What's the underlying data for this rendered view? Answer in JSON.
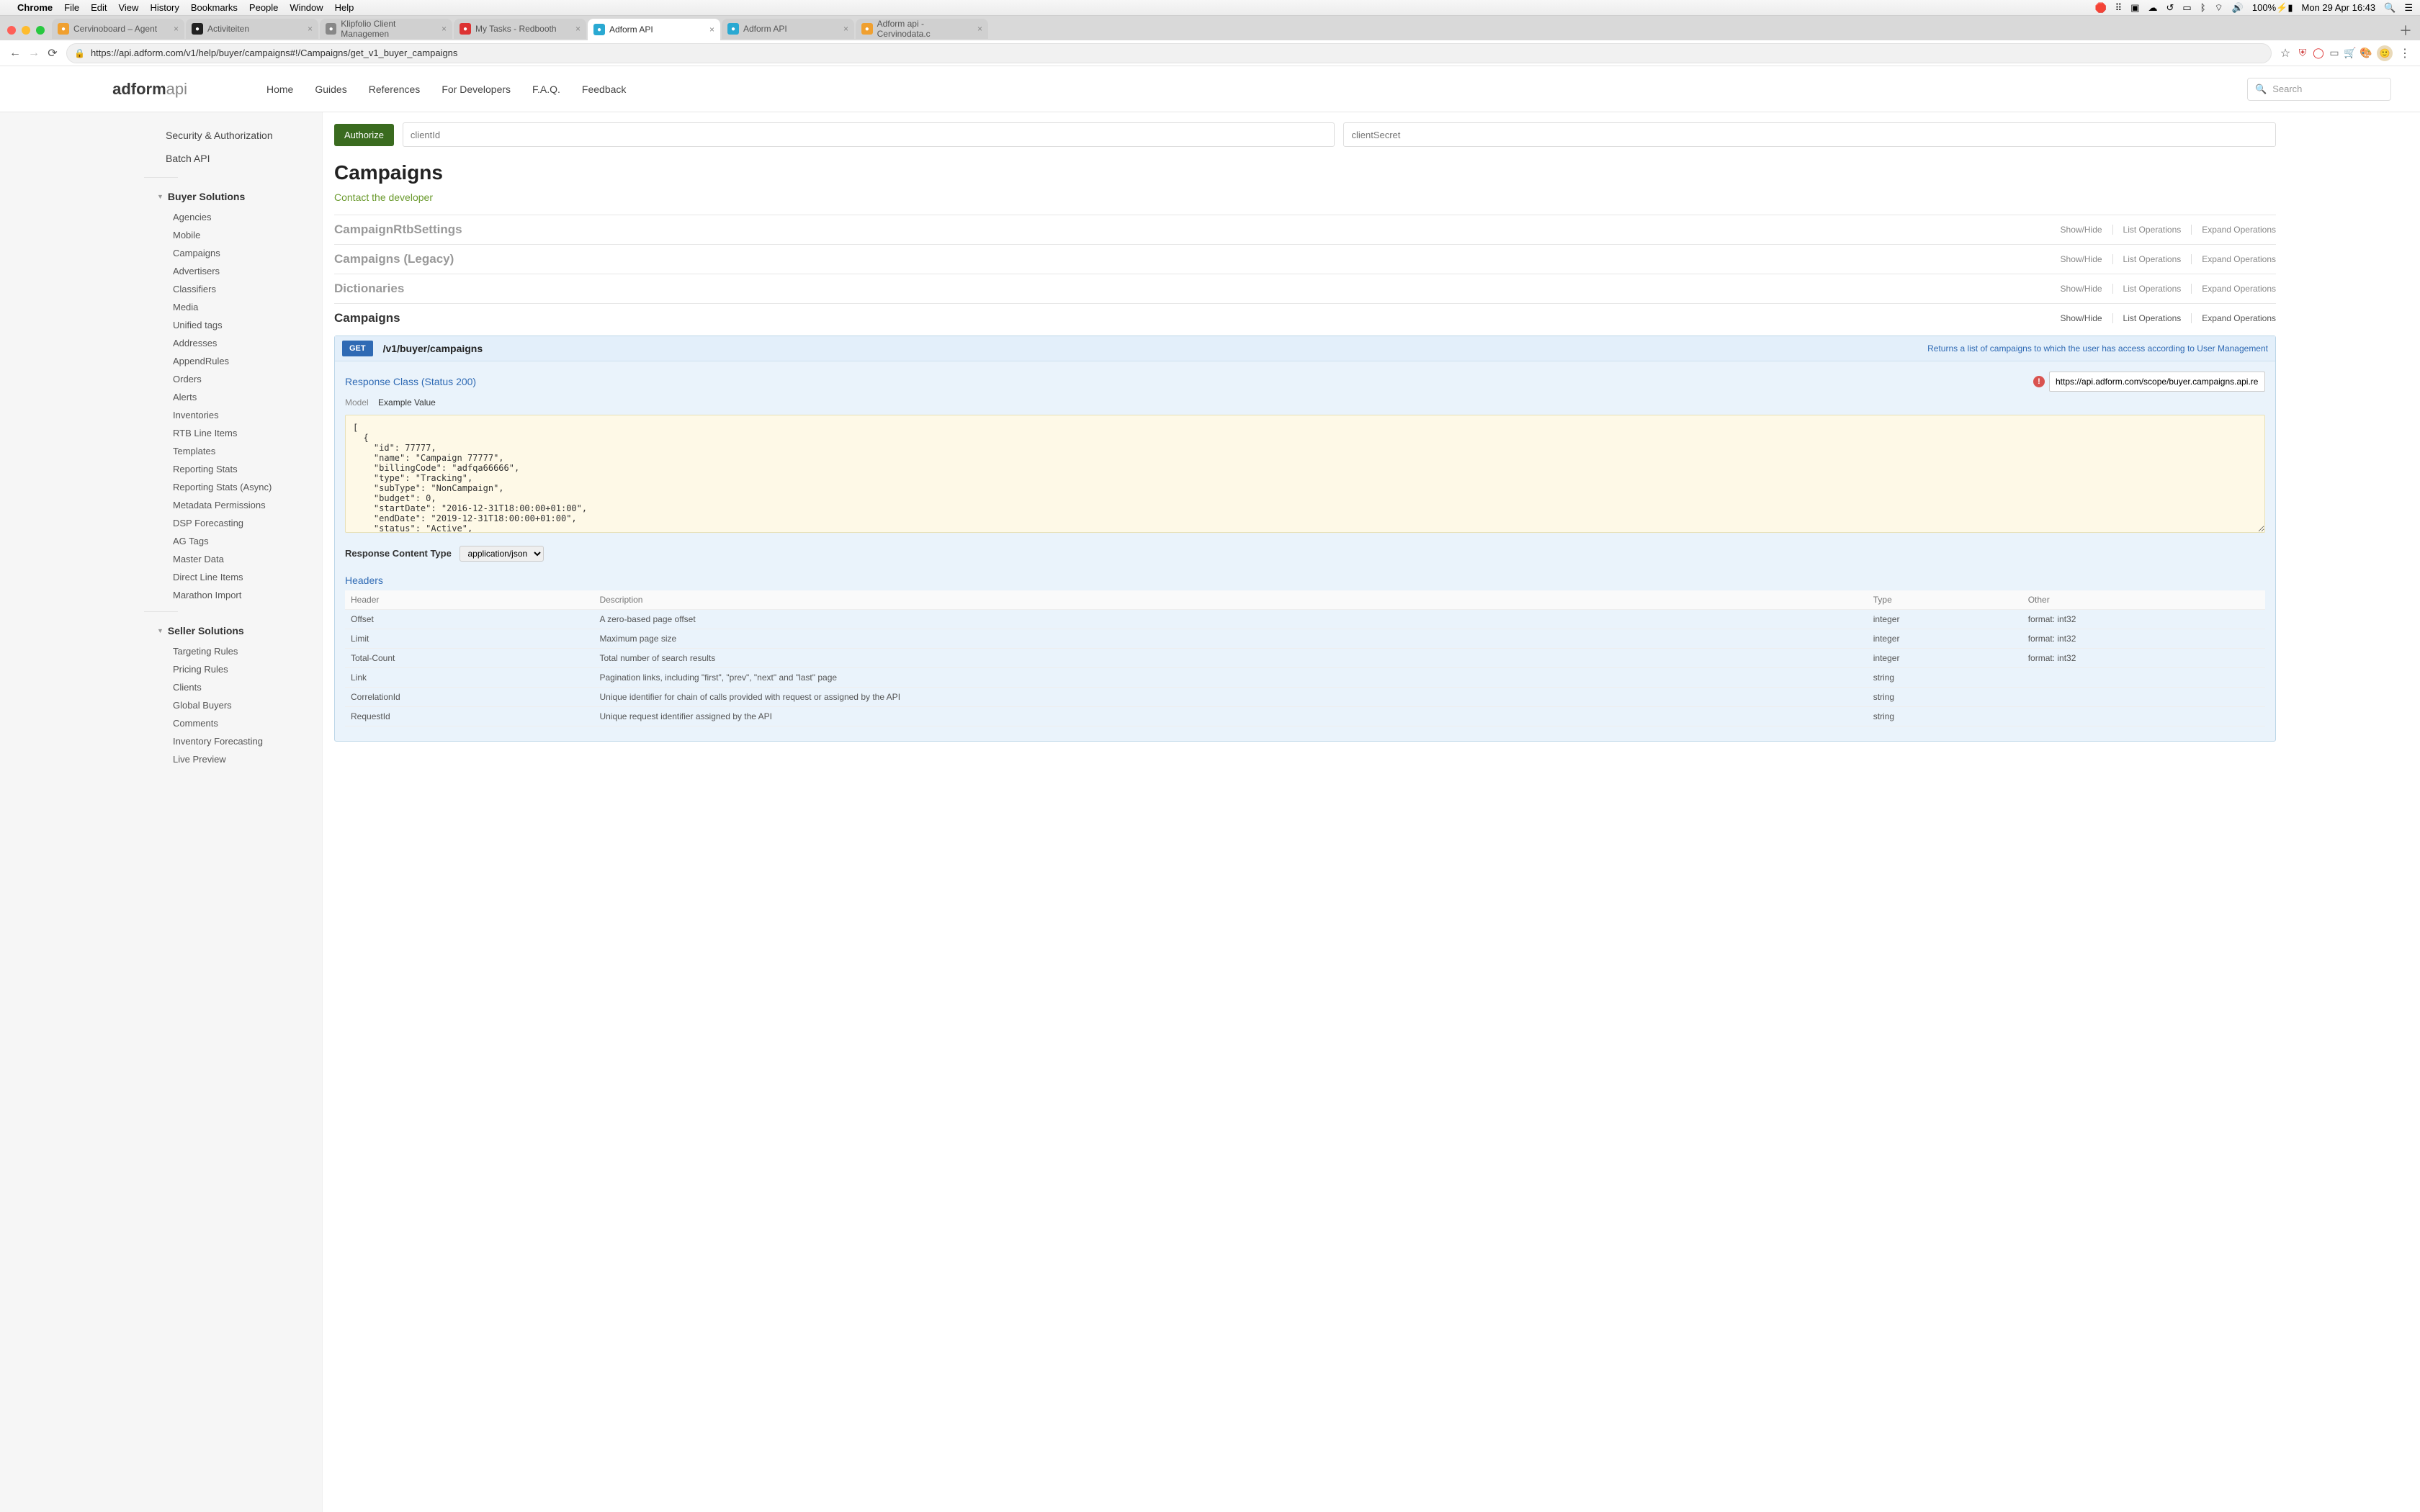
{
  "menubar": {
    "app": "Chrome",
    "items": [
      "File",
      "Edit",
      "View",
      "History",
      "Bookmarks",
      "People",
      "Window",
      "Help"
    ],
    "battery": "100%",
    "clock": "Mon 29 Apr  16:43"
  },
  "tabs": [
    {
      "label": "Cervinoboard – Agent",
      "fav": "#f0a030"
    },
    {
      "label": "Activiteiten",
      "fav": "#222"
    },
    {
      "label": "Klipfolio Client Managemen",
      "fav": "#888"
    },
    {
      "label": "My Tasks - Redbooth",
      "fav": "#d33"
    },
    {
      "label": "Adform API",
      "fav": "#2aa9d2",
      "active": true
    },
    {
      "label": "Adform API",
      "fav": "#2aa9d2"
    },
    {
      "label": "Adform api - Cervinodata.c",
      "fav": "#f0a030"
    }
  ],
  "url": "https://api.adform.com/v1/help/buyer/campaigns#!/Campaigns/get_v1_buyer_campaigns",
  "logo": {
    "a": "adform",
    "b": "api"
  },
  "nav": [
    "Home",
    "Guides",
    "References",
    "For Developers",
    "F.A.Q.",
    "Feedback"
  ],
  "search_placeholder": "Search",
  "sidebar": {
    "top": [
      "Security & Authorization",
      "Batch API"
    ],
    "buyer": {
      "title": "Buyer Solutions",
      "items": [
        "Agencies",
        "Mobile",
        "Campaigns",
        "Advertisers",
        "Classifiers",
        "Media",
        "Unified tags",
        "Addresses",
        "AppendRules",
        "Orders",
        "Alerts",
        "Inventories",
        "RTB Line Items",
        "Templates",
        "Reporting Stats",
        "Reporting Stats (Async)",
        "Metadata Permissions",
        "DSP Forecasting",
        "AG Tags",
        "Master Data",
        "Direct Line Items",
        "Marathon Import"
      ]
    },
    "seller": {
      "title": "Seller Solutions",
      "items": [
        "Targeting Rules",
        "Pricing Rules",
        "Clients",
        "Global Buyers",
        "Comments",
        "Inventory Forecasting",
        "Live Preview"
      ]
    }
  },
  "auth": {
    "btn": "Authorize",
    "clientId": "clientId",
    "clientSecret": "clientSecret"
  },
  "page": {
    "title": "Campaigns",
    "contact": "Contact the developer"
  },
  "sections": [
    {
      "title": "CampaignRtbSettings",
      "ops": [
        "Show/Hide",
        "List Operations",
        "Expand Operations"
      ]
    },
    {
      "title": "Campaigns (Legacy)",
      "ops": [
        "Show/Hide",
        "List Operations",
        "Expand Operations"
      ]
    },
    {
      "title": "Dictionaries",
      "ops": [
        "Show/Hide",
        "List Operations",
        "Expand Operations"
      ]
    },
    {
      "title": "Campaigns",
      "ops": [
        "Show/Hide",
        "List Operations",
        "Expand Operations"
      ],
      "active": true
    }
  ],
  "endpoint": {
    "method": "GET",
    "path": "/v1/buyer/campaigns",
    "desc": "Returns a list of campaigns to which the user has access according to User Management",
    "responseClass": "Response Class (Status 200)",
    "model": "Model",
    "exampleValue": "Example Value",
    "scope": "https://api.adform.com/scope/buyer.campaigns.api.readonly",
    "example": "[\n  {\n    \"id\": 77777,\n    \"name\": \"Campaign 77777\",\n    \"billingCode\": \"adfqa66666\",\n    \"type\": \"Tracking\",\n    \"subType\": \"NonCampaign\",\n    \"budget\": 0,\n    \"startDate\": \"2016-12-31T18:00:00+01:00\",\n    \"endDate\": \"2019-12-31T18:00:00+01:00\",\n    \"status\": \"Active\",",
    "rctLabel": "Response Content Type",
    "rctValue": "application/json",
    "headersTitle": "Headers",
    "headerCols": [
      "Header",
      "Description",
      "Type",
      "Other"
    ],
    "headers": [
      {
        "h": "Offset",
        "d": "A zero-based page offset",
        "t": "integer",
        "o": "format: int32"
      },
      {
        "h": "Limit",
        "d": "Maximum page size",
        "t": "integer",
        "o": "format: int32"
      },
      {
        "h": "Total-Count",
        "d": "Total number of search results",
        "t": "integer",
        "o": "format: int32"
      },
      {
        "h": "Link",
        "d": "Pagination links, including \"first\", \"prev\", \"next\" and \"last\" page",
        "t": "string",
        "o": ""
      },
      {
        "h": "CorrelationId",
        "d": "Unique identifier for chain of calls provided with request or assigned by the API",
        "t": "string",
        "o": ""
      },
      {
        "h": "RequestId",
        "d": "Unique request identifier assigned by the API",
        "t": "string",
        "o": ""
      }
    ]
  }
}
